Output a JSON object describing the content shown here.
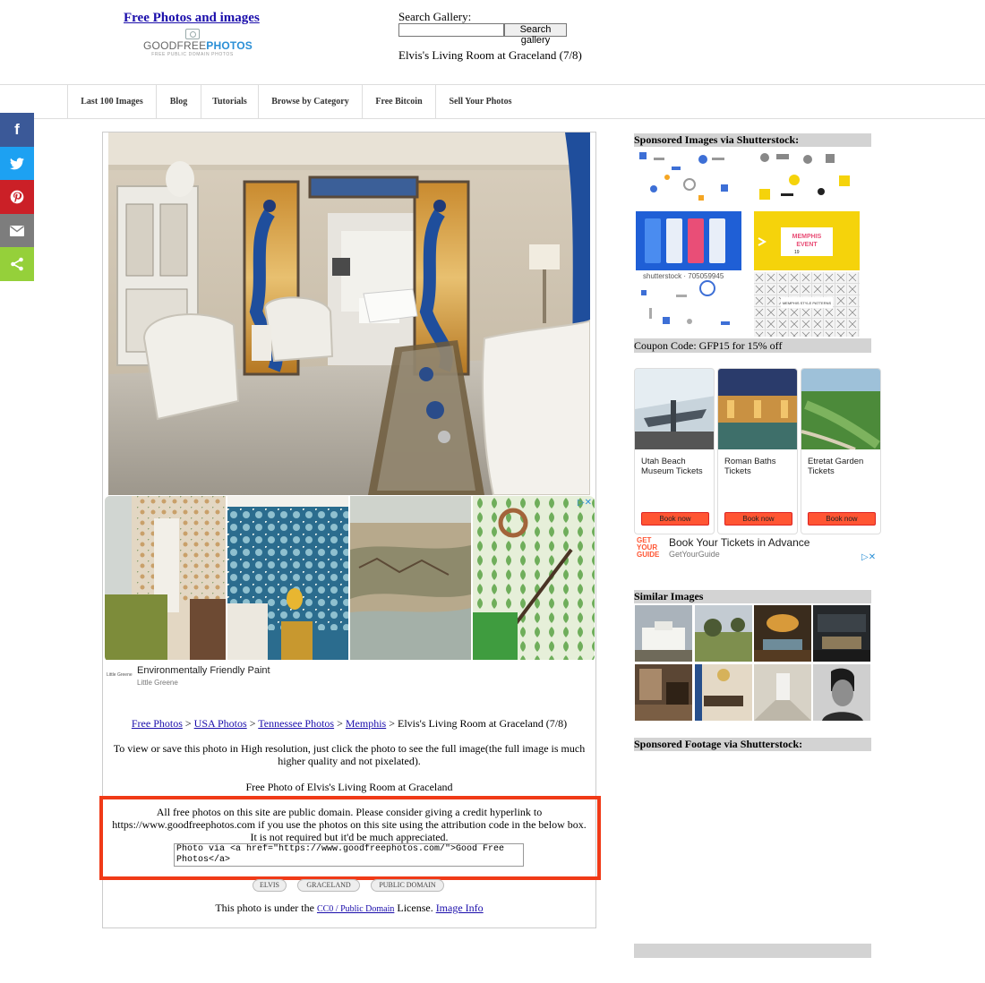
{
  "header": {
    "site_title": "Free Photos and images",
    "logo_word_part1": "GOODFREE",
    "logo_word_part2": "PHOTOS",
    "logo_tagline": "FREE PUBLIC DOMAIN PHOTOS",
    "search_label": "Search Gallery:",
    "search_value": "",
    "search_button": "Search gallery",
    "page_heading": "Elvis's Living Room at Graceland (7/8)"
  },
  "nav": {
    "items": [
      {
        "label": "Last 100 Images"
      },
      {
        "label": "Blog"
      },
      {
        "label": "Tutorials"
      },
      {
        "label": "Browse by Category"
      },
      {
        "label": "Free Bitcoin"
      },
      {
        "label": "Sell Your Photos"
      }
    ]
  },
  "social": {
    "facebook_glyph": "f",
    "colors": {
      "facebook": "#3b5998",
      "twitter": "#1da1f2",
      "pinterest": "#cb2027",
      "email": "#7d7d7d",
      "share": "#95d03a"
    }
  },
  "ad": {
    "choices": "▷✕",
    "logo_text": "Little Greene",
    "title": "Environmentally Friendly Paint",
    "advertiser": "Little Greene"
  },
  "breadcrumb": {
    "items": [
      "Free Photos",
      "USA Photos",
      "Tennessee Photos",
      "Memphis"
    ],
    "separator": ">",
    "current": "Elvis's Living Room at Graceland (7/8)"
  },
  "content": {
    "description": "To view or save this photo in High resolution, just click the photo to see the full image(the full image is much higher quality and not pixelated).",
    "free_photo_title": "Free Photo of Elvis's Living Room at Graceland",
    "public_domain_text": "All free photos on this site are public domain. Please consider giving a credit hyperlink to https://www.goodfreephotos.com if you use the photos on this site using the attribution code in the below box. It is not required but it'd be much appreciated.",
    "attribution_code": "Photo via <a href=\"https://www.goodfreephotos.com/\">Good Free Photos</a>",
    "tags": [
      "ELVIS",
      "GRACELAND",
      "PUBLIC DOMAIN"
    ],
    "license_prefix": "This photo is under the",
    "license_link": "CC0 / Public Domain",
    "license_suffix": "License.",
    "image_info_link": "Image Info",
    "highlight_color": "#f03a17"
  },
  "sidebar": {
    "sponsored_images_title": "Sponsored Images via Shutterstock:",
    "shutterstock_watermark": "shutterstock · 705059945",
    "coupon_text": "Coupon Code: GFP15 for 15% off",
    "memphis_card": {
      "line1": "MEMPHIS",
      "line2": "EVENT",
      "day": "19"
    },
    "pattern_caption": "MEMPHIS STYLE PATTERNS",
    "getyourguide": {
      "cards": [
        {
          "title": "Utah Beach Museum Tickets",
          "button": "Book now"
        },
        {
          "title": "Roman Baths Tickets",
          "button": "Book now"
        },
        {
          "title": "Etretat Garden Tickets",
          "button": "Book now"
        }
      ],
      "logo_lines": [
        "GET",
        "YOUR",
        "GUIDE"
      ],
      "headline": "Book Your Tickets in Advance",
      "advertiser": "GetYourGuide",
      "choices": "▷✕",
      "accent": "#ff5533"
    },
    "similar_images_title": "Similar Images",
    "sponsored_footage_title": "Sponsored Footage via Shutterstock:"
  }
}
